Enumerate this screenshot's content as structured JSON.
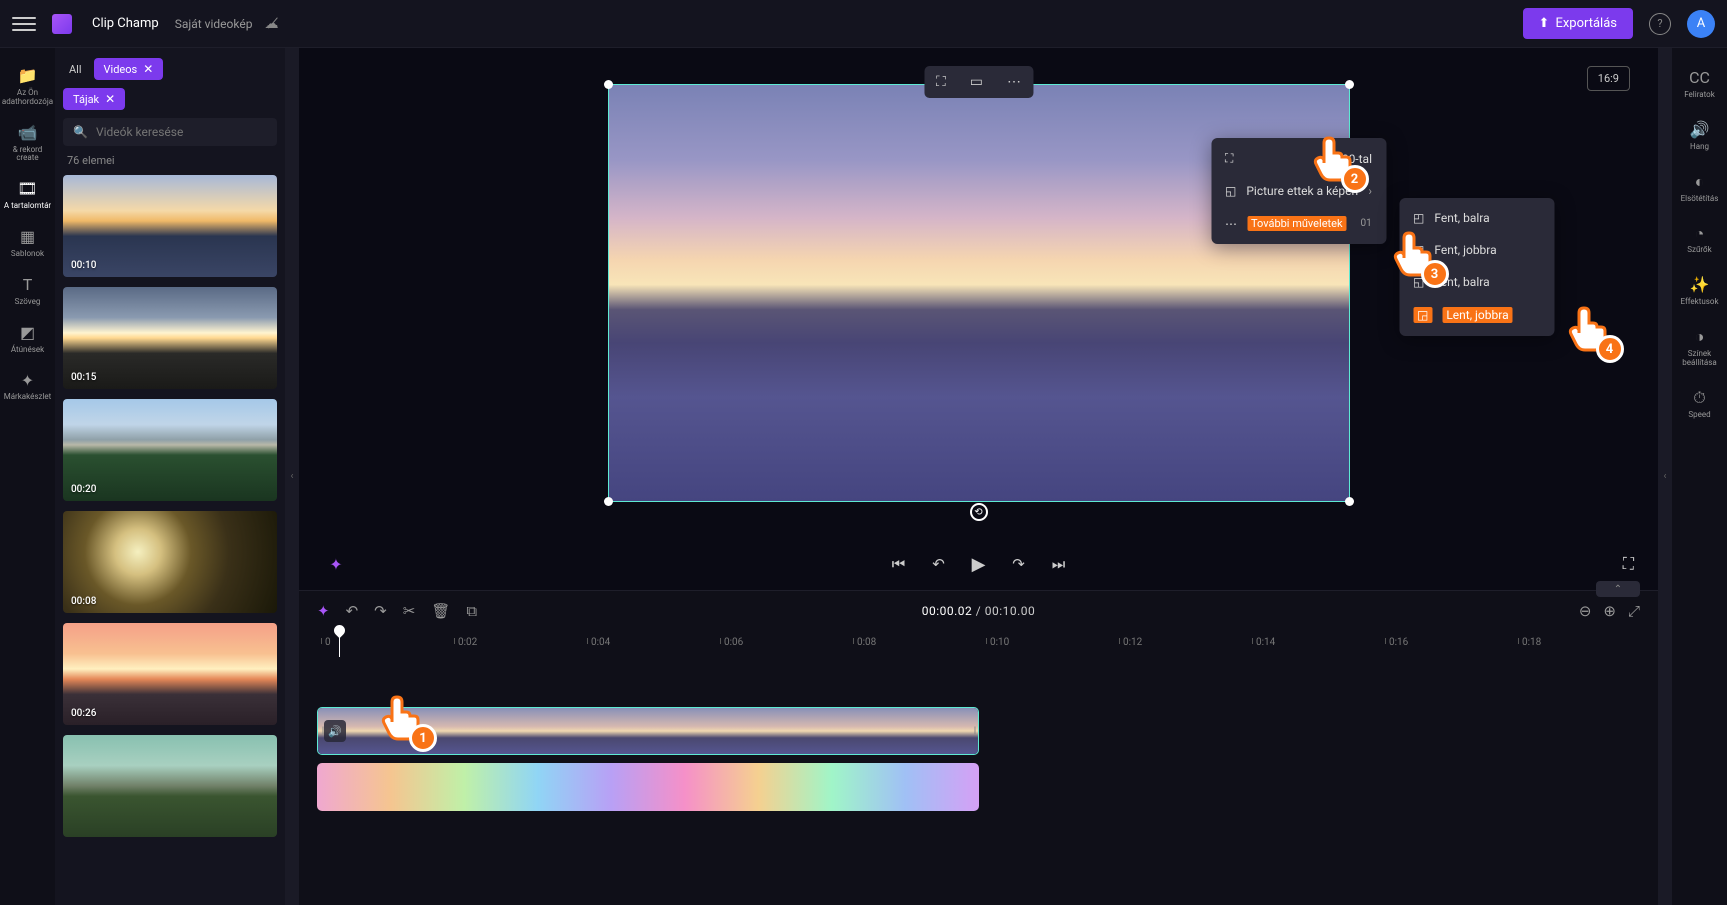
{
  "header": {
    "app_name": "Clip Champ",
    "project_name": "Saját videokép",
    "export_label": "Exportálás",
    "avatar_initial": "A",
    "aspect_ratio": "16:9"
  },
  "left_rail": [
    {
      "label": "Az Ön adathordozója",
      "icon": "📁"
    },
    {
      "label": "&amp; rekord create",
      "icon": "📹"
    },
    {
      "label": "A tartalomtár",
      "icon": "🎞"
    },
    {
      "label": "Sablonok",
      "icon": "▦"
    },
    {
      "label": "Szöveg",
      "icon": "T"
    },
    {
      "label": "Átúnések",
      "icon": "◩"
    },
    {
      "label": "Márkakészlet",
      "icon": "✦"
    }
  ],
  "right_rail": [
    {
      "label": "Feliratok",
      "icon": "CC"
    },
    {
      "label": "Hang",
      "icon": "🔊"
    },
    {
      "label": "Elsötétítás",
      "icon": "◐"
    },
    {
      "label": "Szűrők",
      "icon": "◔"
    },
    {
      "label": "Effektusok",
      "icon": "✨"
    },
    {
      "label": "Színek beállítása",
      "icon": "◑"
    },
    {
      "label": "Speed",
      "icon": "⏱"
    }
  ],
  "media_panel": {
    "chip_all": "All",
    "chip_videos": "Videos",
    "chip_landscapes": "Tájak",
    "search_placeholder": "Videók keresése",
    "count": "76",
    "count_suffix": "elemei",
    "items": [
      {
        "dur": "00:10",
        "class": "t-sunset"
      },
      {
        "dur": "00:15",
        "class": "t-sunrise"
      },
      {
        "dur": "00:20",
        "class": "t-alpine"
      },
      {
        "dur": "00:08",
        "class": "t-forest"
      },
      {
        "dur": "00:26",
        "class": "t-mtnsun"
      },
      {
        "dur": "",
        "class": "t-green"
      }
    ]
  },
  "context_menu": {
    "item1_suffix": "900-tal",
    "item2": "Picture ettek a képen",
    "item3": "További műveletek",
    "item3_suffix": "01"
  },
  "submenu": {
    "opt1": "Fent, balra",
    "opt2": "Fent, jobbra",
    "opt3": "Lent, balra",
    "opt4": "Lent, jobbra"
  },
  "transport": {
    "current": "00:00.02",
    "total": "00:10.00"
  },
  "ruler": [
    "0",
    "0:02",
    "0:04",
    "0:06",
    "0:08",
    "0:10",
    "0:12",
    "0:14",
    "0:16",
    "0:18"
  ],
  "click_labels": {
    "1": "1",
    "2": "2",
    "3": "3",
    "4": "4"
  }
}
